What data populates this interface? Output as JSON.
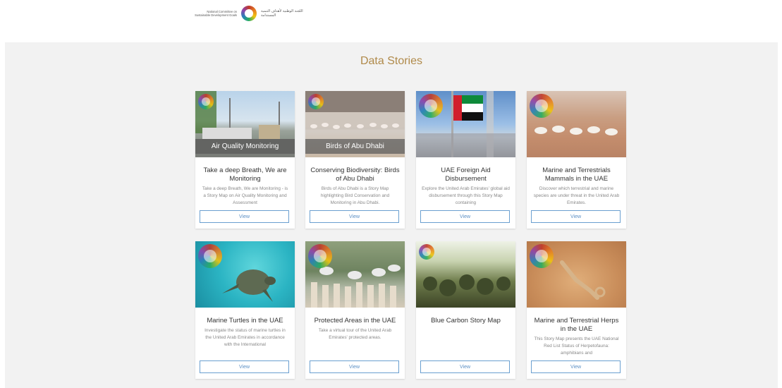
{
  "header": {
    "logo_en": "National Committee on Sustainable Development Goals",
    "logo_ar": "اللجنة الوطنية لأهداف التنمية المستدامة"
  },
  "page_title": "Data Stories",
  "cards": [
    {
      "title": "Take a deep Breath, We are Monitoring",
      "desc": "Take a deep Breath, We are Monitoring - is a Story Map on Air Quality Monitoring and Assessment",
      "overlay": "Air Quality Monitoring",
      "view_label": "View",
      "image_icon": "air-quality-photo"
    },
    {
      "title": "Conserving Biodiversity: Birds of Abu Dhabi",
      "desc": "Birds of Abu Dhabi is a Story Map highlighting Bird Conservation and Monitoring in Abu Dhabi.",
      "overlay": "Birds of Abu  Dhabi",
      "view_label": "View",
      "image_icon": "flamingos-photo"
    },
    {
      "title": "UAE Foreign Aid Disbursement",
      "desc": "Explore the United Arab Emirates' global aid disbursement through this Story Map containing",
      "overlay": "",
      "view_label": "View",
      "image_icon": "uae-flag-photo"
    },
    {
      "title": "Marine and Terrestrials Mammals in the UAE",
      "desc": "Discover which terrestrial and marine species are under threat in the United Arab Emirates.",
      "overlay": "",
      "view_label": "View",
      "image_icon": "oryx-photo"
    },
    {
      "title": "Marine Turtles in the UAE",
      "desc": "Investigate the status of marine turtles in the United Arab Emirates in accordance with the International",
      "overlay": "",
      "view_label": "View",
      "image_icon": "turtle-photo"
    },
    {
      "title": "Protected Areas in the UAE",
      "desc": "Take a virtual tour of the United Arab Emirates' protected areas.",
      "overlay": "",
      "view_label": "View",
      "image_icon": "gulls-photo"
    },
    {
      "title": "Blue Carbon Story Map",
      "desc": "",
      "overlay": "",
      "view_label": "View",
      "image_icon": "mangrove-photo"
    },
    {
      "title": "Marine and Terrestrial Herps in the UAE",
      "desc": "This Story Map presents the UAE National Red List Status of Herpetofauna: amphibians and",
      "overlay": "",
      "view_label": "View",
      "image_icon": "chameleon-photo"
    }
  ],
  "colors": {
    "accent_title": "#b08a4a",
    "button_border": "#6a9fd0",
    "page_bg": "#f2f2f2"
  }
}
